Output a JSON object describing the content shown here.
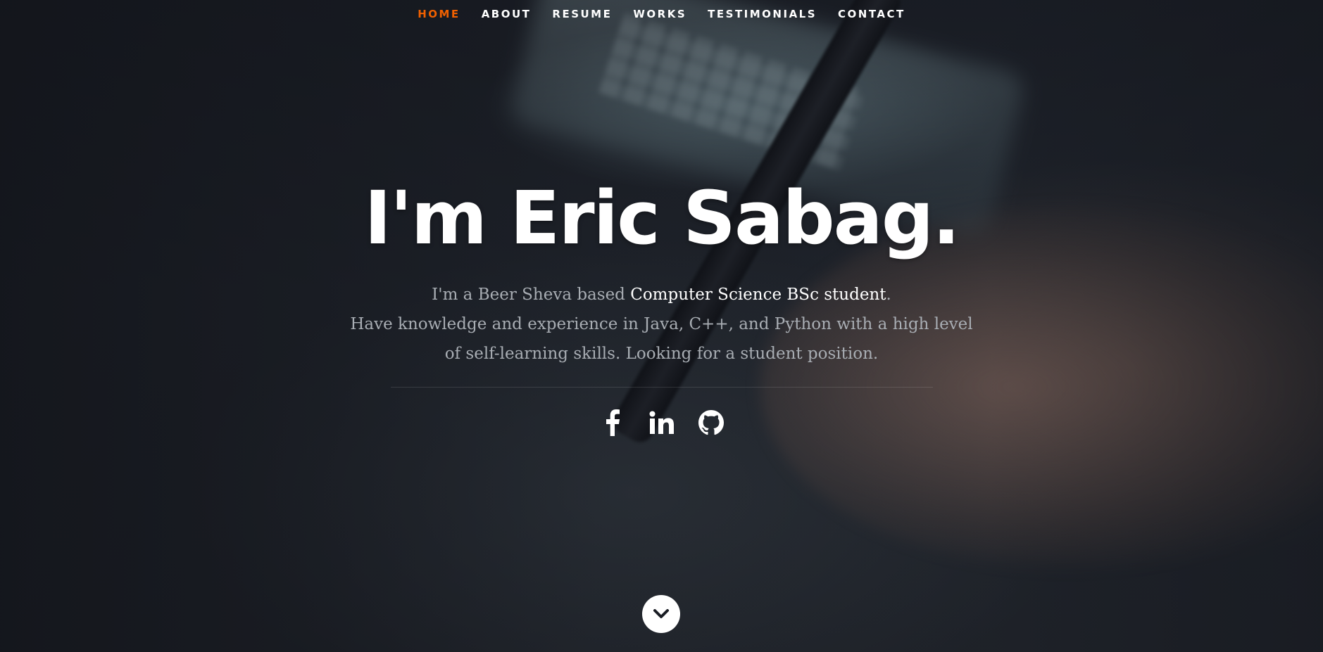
{
  "nav": {
    "items": [
      {
        "label": "HOME",
        "active": true
      },
      {
        "label": "ABOUT",
        "active": false
      },
      {
        "label": "RESUME",
        "active": false
      },
      {
        "label": "WORKS",
        "active": false
      },
      {
        "label": "TESTIMONIALS",
        "active": false
      },
      {
        "label": "CONTACT",
        "active": false
      }
    ],
    "active_color": "#f06000"
  },
  "banner": {
    "heading": "I'm Eric Sabag.",
    "intro_prefix": "I'm a Beer Sheva based ",
    "intro_highlight": "Computer Science BSc student",
    "intro_period": ".",
    "intro_line2": "Have knowledge and experience in Java, C++, and Python with a high level of self-learning skills. Looking for a student position."
  },
  "social": {
    "icons": [
      "facebook-icon",
      "linkedin-icon",
      "github-icon"
    ]
  },
  "scroll": {
    "icon": "chevron-down-icon"
  }
}
